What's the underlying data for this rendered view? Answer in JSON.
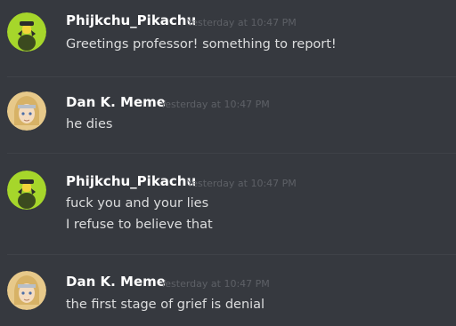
{
  "messages": [
    {
      "username": "Phijkchu_Pikachu",
      "timestamp": "Yesterday at 10:47 PM",
      "avatar_icon": "pikachu-avatar-icon",
      "lines": [
        "Greetings professor! something to report!"
      ]
    },
    {
      "username": "Dan K. Meme",
      "timestamp": "Yesterday at 10:47 PM",
      "avatar_icon": "anime-character-avatar-icon",
      "lines": [
        "he dies"
      ]
    },
    {
      "username": "Phijkchu_Pikachu",
      "timestamp": "Yesterday at 10:47 PM",
      "avatar_icon": "pikachu-avatar-icon",
      "lines": [
        "fuck you and your lies",
        "I refuse to believe that"
      ]
    },
    {
      "username": "Dan K. Meme",
      "timestamp": "Yesterday at 10:47 PM",
      "avatar_icon": "anime-character-avatar-icon",
      "lines": [
        "the first stage of grief is denial"
      ]
    }
  ],
  "colors": {
    "background": "#36393f",
    "username": "#ffffff",
    "message_text": "#dcddde",
    "timestamp": "#5d6066",
    "divider": "#3f4248",
    "pikachu_avatar_bg": "#a6d62b",
    "anime_avatar_bg": "#e7c98a"
  }
}
